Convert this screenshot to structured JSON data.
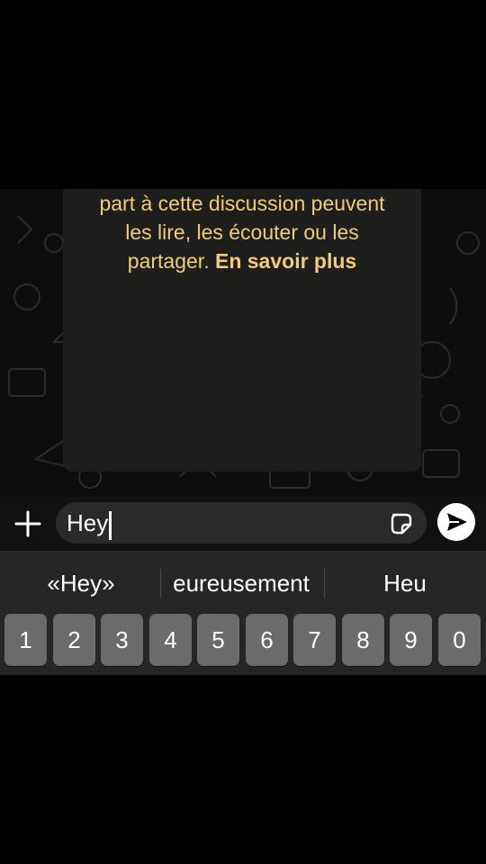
{
  "notice": {
    "line1": "part à cette discussion peuvent",
    "line2": "les lire, les écouter ou les",
    "line3_prefix": "partager.",
    "line3_link": "En savoir plus"
  },
  "composer": {
    "text": "Hey",
    "plus_icon": "plus-icon",
    "sticker_icon": "sticker-icon",
    "send_icon": "send-icon"
  },
  "keyboard": {
    "suggestions": [
      "«Hey»",
      "eureusement",
      "Heu"
    ],
    "digits": [
      "1",
      "2",
      "3",
      "4",
      "5",
      "6",
      "7",
      "8",
      "9",
      "0"
    ]
  },
  "colors": {
    "notice_text": "#f2cc7b",
    "notice_bubble": "#1e1e1c",
    "key": "#6b6b6b",
    "keyboard_bg": "#262626"
  }
}
